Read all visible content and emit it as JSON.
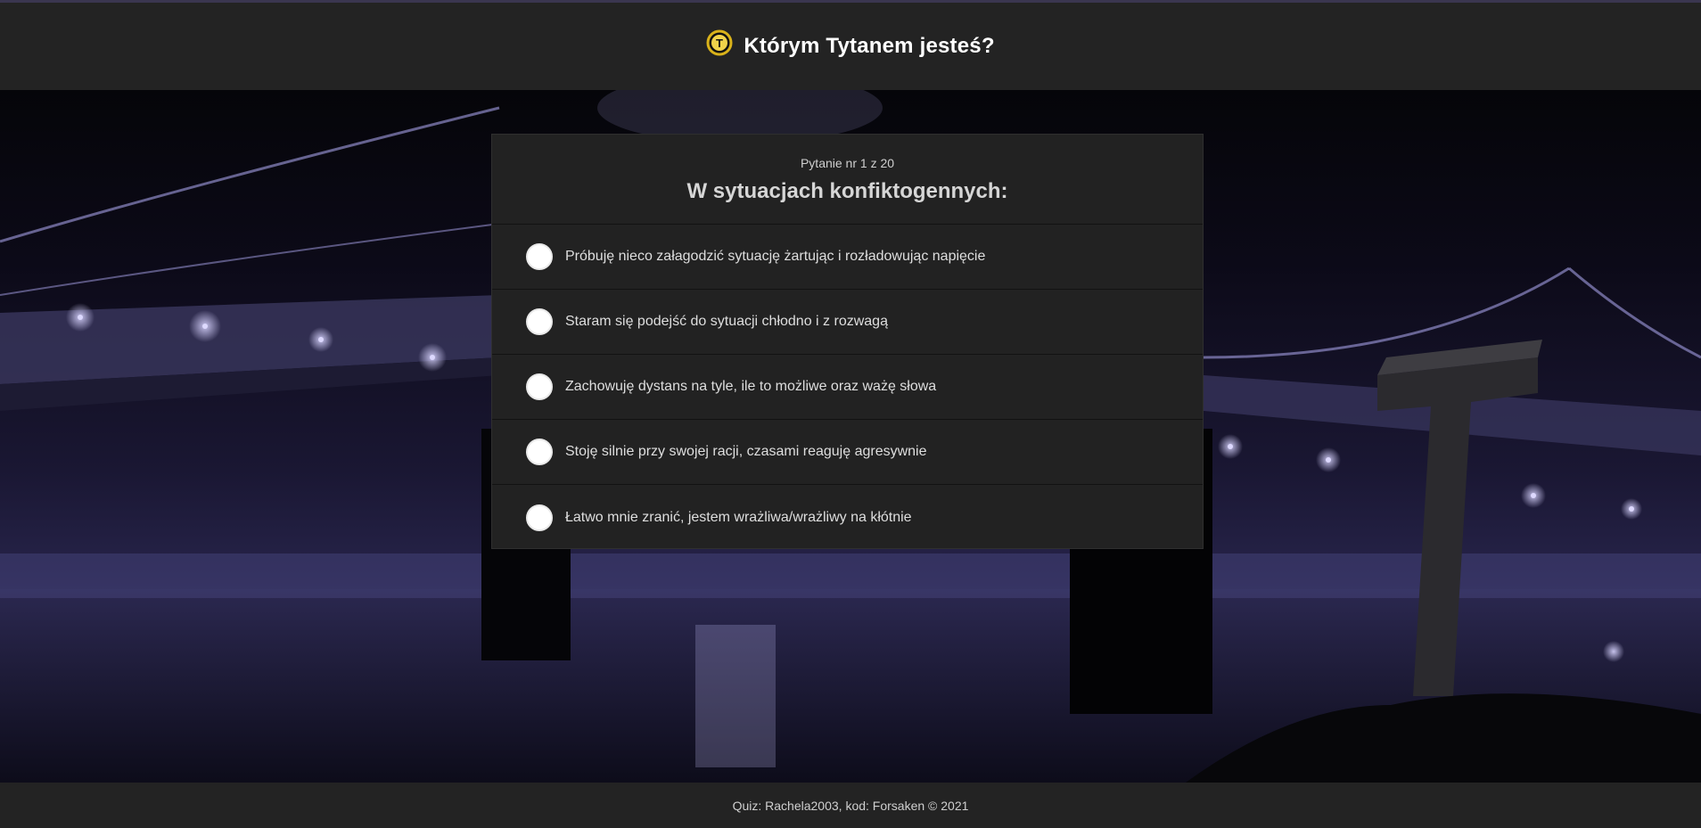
{
  "header": {
    "title": "Którym Tytanem jesteś?",
    "logo_letter": "T"
  },
  "question": {
    "counter": "Pytanie nr 1 z 20",
    "title": "W sytuacjach konfiktogennych:",
    "options": [
      "Próbuję nieco załagodzić sytuację żartując i rozładowując napięcie",
      "Staram się podejść do sytuacji chłodno i z rozwagą",
      "Zachowuję dystans na tyle, ile to możliwe oraz ważę słowa",
      "Stoję silnie przy swojej racji, czasami reaguję agresywnie",
      "Łatwo mnie zranić, jestem wrażliwa/wrażliwy na kłótnie"
    ]
  },
  "footer": {
    "text": "Quiz: Rachela2003, kod: Forsaken © 2021"
  },
  "colors": {
    "panel": "#222222",
    "header": "#232323",
    "accent_gold": "#d9b21a",
    "lights": "#c9c4ff"
  }
}
